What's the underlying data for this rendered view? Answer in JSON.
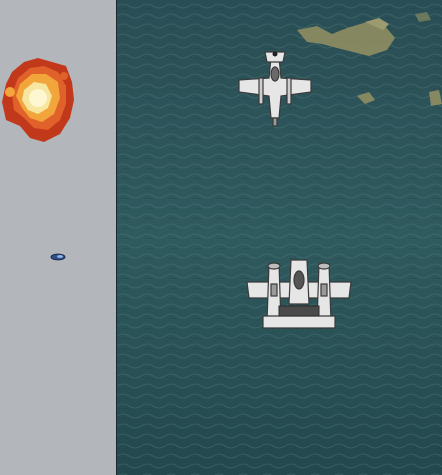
{
  "game": {
    "scene": "vertical-scrolling-shooter",
    "colors": {
      "panel": "#b3b6bb",
      "ocean_deep": "#1c4047",
      "ocean_mid": "#2f5a5e",
      "ocean_light": "#4d7a78",
      "island": "#8f8e62",
      "plane_body": "#e6e6e6",
      "plane_outline": "#3a3a3a",
      "explosion_core": "#f6e6a0",
      "explosion_mid": "#f2a53a",
      "explosion_edge": "#c2381b",
      "bullet": "#2f4f8a"
    },
    "icons": [
      "explosion-icon",
      "enemy-bullet-icon",
      "enemy-fighter-icon",
      "player-fighter-icon"
    ]
  }
}
